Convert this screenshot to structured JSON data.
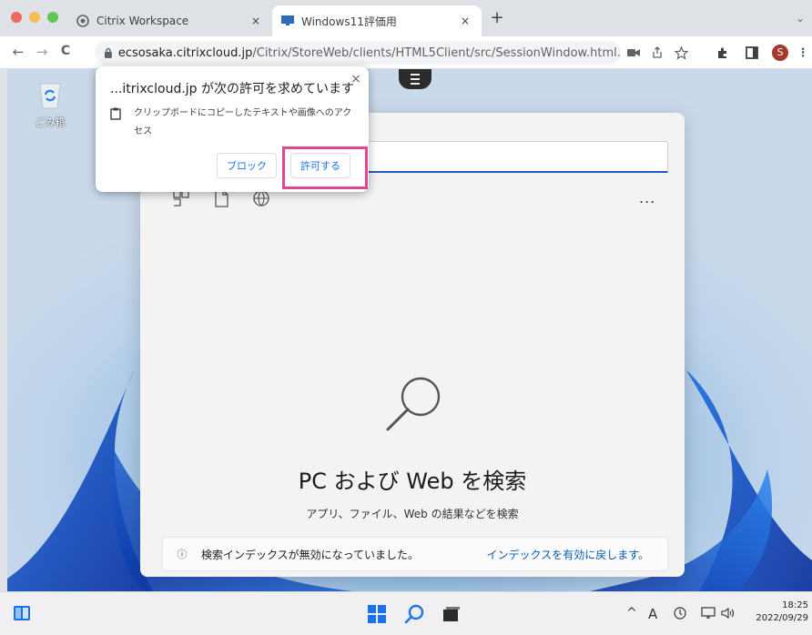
{
  "browser": {
    "tabs": [
      {
        "title": "Citrix Workspace",
        "close": "×"
      },
      {
        "title": "Windows11評価用",
        "close": "×"
      }
    ],
    "new_tab": "+",
    "tab_menu": "⌄",
    "url_host": "ecsosaka.citrixcloud.jp",
    "url_path": "/Citrix/StoreWeb/clients/HTML5Client/src/SessionWindow.html...",
    "profile_initial": "S",
    "nav": {
      "back": "←",
      "forward": "→",
      "reload": "C"
    }
  },
  "permission_popup": {
    "title": "...itrixcloud.jp が次の許可を求めています",
    "description": "クリップボードにコピーしたテキストや画像へのアクセス",
    "block_label": "ブロック",
    "allow_label": "許可する",
    "close": "×"
  },
  "desktop": {
    "recycle_bin_label": "ごみ箱"
  },
  "search_panel": {
    "more": "...",
    "heading": "PC および Web を検索",
    "subheading": "アプリ、ファイル、Web の結果などを検索",
    "info_text": "検索インデックスが無効になっていました。",
    "info_link": "インデックスを有効に戻します。"
  },
  "taskbar": {
    "tray_chevron": "^",
    "ime": "A",
    "time": "18:25",
    "date": "2022/09/29"
  },
  "colors": {
    "accent": "#1a73e8",
    "highlight": "#e0478e",
    "windows_blue": "#0a5bb5"
  }
}
